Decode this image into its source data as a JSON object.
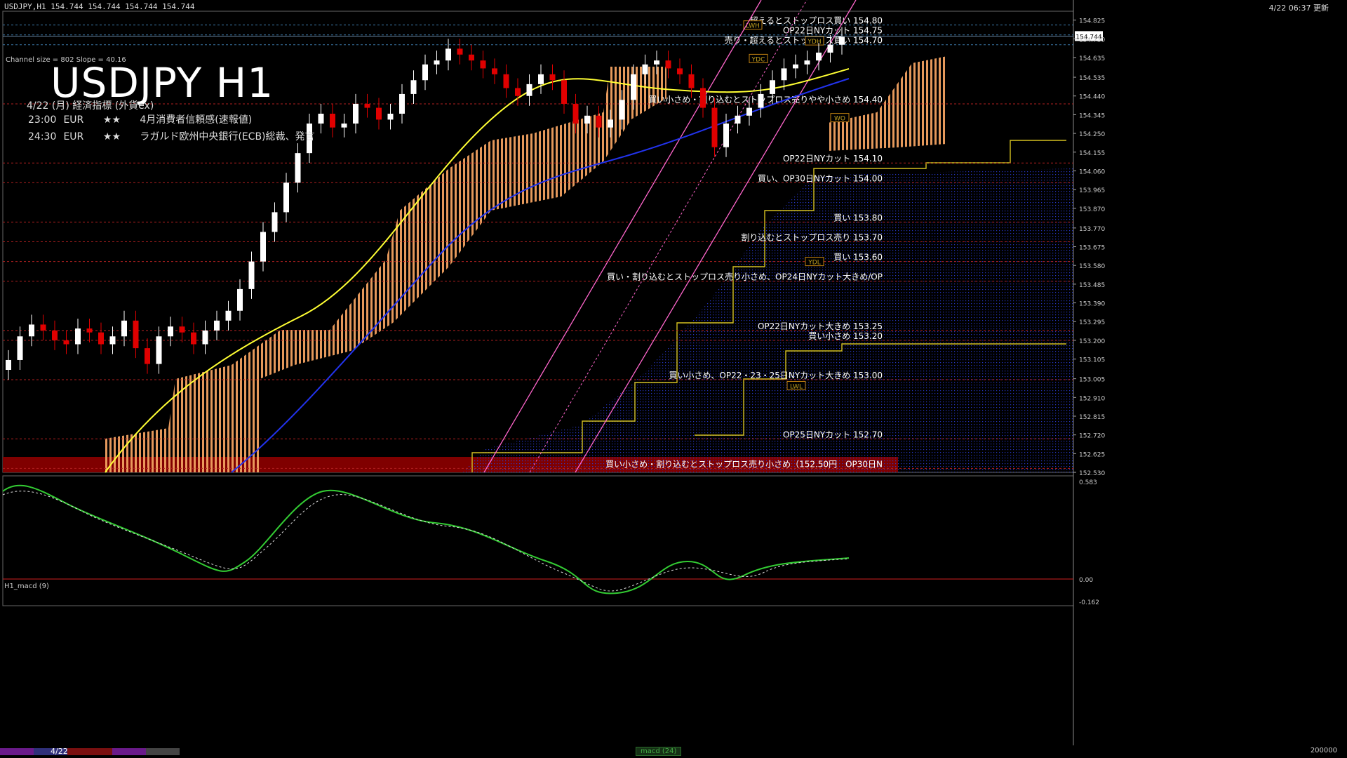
{
  "header": {
    "symbol_line": "USDJPY,H1  154.744 154.744 154.744 154.744",
    "updated": "4/22 06:37 更新"
  },
  "overlay": {
    "channel_info": "Channel size = 802 Slope = 40.16",
    "title": "USDJPY H1",
    "event_date": "4/22 (月) 経済指標 (外貨ex)",
    "events": [
      {
        "time": "23:00",
        "currency": "EUR",
        "stars": "★★",
        "label": "4月消費者信頼感(速報値)"
      },
      {
        "time": "24:30",
        "currency": "EUR",
        "stars": "★★",
        "label": "ラガルド欧州中央銀行(ECB)総裁、発言"
      }
    ]
  },
  "price_scale": {
    "current_price": "154.744",
    "ticks": [
      "154.825",
      "154.730",
      "154.635",
      "154.535",
      "154.440",
      "154.345",
      "154.250",
      "154.155",
      "154.060",
      "153.965",
      "153.870",
      "153.770",
      "153.675",
      "153.580",
      "153.485",
      "153.390",
      "153.295",
      "153.200",
      "153.105",
      "153.005",
      "152.910",
      "152.815",
      "152.720",
      "152.625",
      "152.530"
    ]
  },
  "macd_panel": {
    "label": "H1_macd (9)",
    "ticks": [
      "0.583",
      "0.00",
      "-0.162"
    ]
  },
  "time_axis": {
    "date": "4/22",
    "tab": "macd (24)",
    "volume_label": "200000"
  },
  "chart_data": {
    "type": "line",
    "title": "USDJPY H1",
    "ylim": [
      152.53,
      154.87
    ],
    "levels": [
      {
        "price": 154.8,
        "label": "超えるとストップロス買い 154.80"
      },
      {
        "price": 154.75,
        "label": "OP22日NYカット 154.75"
      },
      {
        "price": 154.7,
        "label": "売り・超えるとストップロス買い 154.70"
      },
      {
        "price": 154.4,
        "label": "買い小さめ・割り込むとストップロス売りやや小さめ 154.40"
      },
      {
        "price": 154.1,
        "label": "OP22日NYカット 154.10"
      },
      {
        "price": 154.0,
        "label": "買い、OP30日NYカット 154.00"
      },
      {
        "price": 153.8,
        "label": "買い 153.80"
      },
      {
        "price": 153.7,
        "label": "割り込むとストップロス売り 153.70"
      },
      {
        "price": 153.6,
        "label": "買い 153.60"
      },
      {
        "price": 153.5,
        "label": "買い・割り込むとストップロス売り小さめ、OP24日NYカット大きめ/OP"
      },
      {
        "price": 153.25,
        "label": "OP22日NYカット大きめ 153.25"
      },
      {
        "price": 153.2,
        "label": "買い小さめ 153.20"
      },
      {
        "price": 153.0,
        "label": "買い小さめ、OP22・23・25日NYカット大きめ 153.00"
      },
      {
        "price": 152.7,
        "label": "OP25日NYカット 152.70"
      },
      {
        "price": 152.55,
        "label": "買い小さめ・割り込むとストップロス売り小さめ（152.50円　OP30日N"
      }
    ],
    "markers": [
      {
        "price": 154.8,
        "label": "LWH"
      },
      {
        "price": 154.72,
        "label": "YDH"
      },
      {
        "price": 154.63,
        "label": "YDC"
      },
      {
        "price": 154.33,
        "label": "WO"
      },
      {
        "price": 153.6,
        "label": "YDL"
      },
      {
        "price": 152.97,
        "label": "LWL"
      }
    ],
    "series": [
      {
        "name": "close",
        "color": "#ffffff",
        "values": [
          153.1,
          153.22,
          153.28,
          153.25,
          153.2,
          153.18,
          153.26,
          153.24,
          153.18,
          153.22,
          153.3,
          153.16,
          153.08,
          153.22,
          153.27,
          153.24,
          153.18,
          153.25,
          153.3,
          153.35,
          153.46,
          153.6,
          153.75,
          153.85,
          154.0,
          154.15,
          154.3,
          154.35,
          154.28,
          154.3,
          154.4,
          154.38,
          154.32,
          154.35,
          154.45,
          154.52,
          154.6,
          154.62,
          154.68,
          154.65,
          154.62,
          154.58,
          154.55,
          154.48,
          154.44,
          154.5,
          154.55,
          154.52,
          154.4,
          154.3,
          154.34,
          154.28,
          154.32,
          154.42,
          154.55,
          154.6,
          154.62,
          154.58,
          154.55,
          154.48,
          154.38,
          154.18,
          154.3,
          154.34,
          154.38,
          154.45,
          154.52,
          154.58,
          154.6,
          154.62,
          154.66,
          154.7,
          154.74
        ]
      }
    ]
  },
  "colors": {
    "background": "#000000",
    "candle_up": "#ffffff",
    "candle_down": "#e00000",
    "ma_long": "#ffff33",
    "ma_blue": "#2233ee",
    "cloud": "#f0a060",
    "channel": "#ff66cc",
    "level_line": "#b02020",
    "macd_line": "#33cc33",
    "signal_line": "#dddddd",
    "support_band": "#800000"
  }
}
